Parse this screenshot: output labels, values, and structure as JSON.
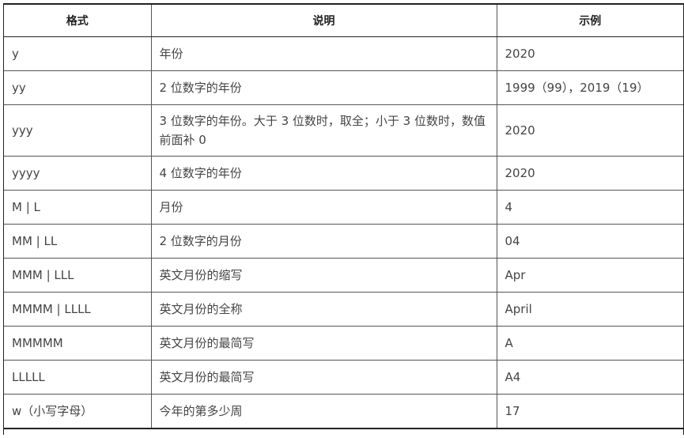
{
  "table": {
    "headers": [
      "格式",
      "说明",
      "示例"
    ],
    "rows": [
      {
        "format": "y",
        "description": "年份",
        "example": "2020"
      },
      {
        "format": "yy",
        "description": "2 位数字的年份",
        "example": "1999（99），2019（19）"
      },
      {
        "format": "yyy",
        "description": "3 位数字的年份。大于 3 位数时，取全；小于 3 位数时，数值前面补 0",
        "example": "2020"
      },
      {
        "format": "yyyy",
        "description": "4 位数字的年份",
        "example": "2020"
      },
      {
        "format": "M | L",
        "description": "月份",
        "example": "4"
      },
      {
        "format": "MM | LL",
        "description": "2 位数字的月份",
        "example": "04"
      },
      {
        "format": "MMM | LLL",
        "description": "英文月份的缩写",
        "example": "Apr"
      },
      {
        "format": "MMMM | LLLL",
        "description": "英文月份的全称",
        "example": "April"
      },
      {
        "format": "MMMMM",
        "description": "英文月份的最简写",
        "example": "A"
      },
      {
        "format": "LLLLL",
        "description": "英文月份的最简写",
        "example": "A4"
      },
      {
        "format": "w（小写字母）",
        "description": "今年的第多少周",
        "example": "17"
      }
    ]
  }
}
